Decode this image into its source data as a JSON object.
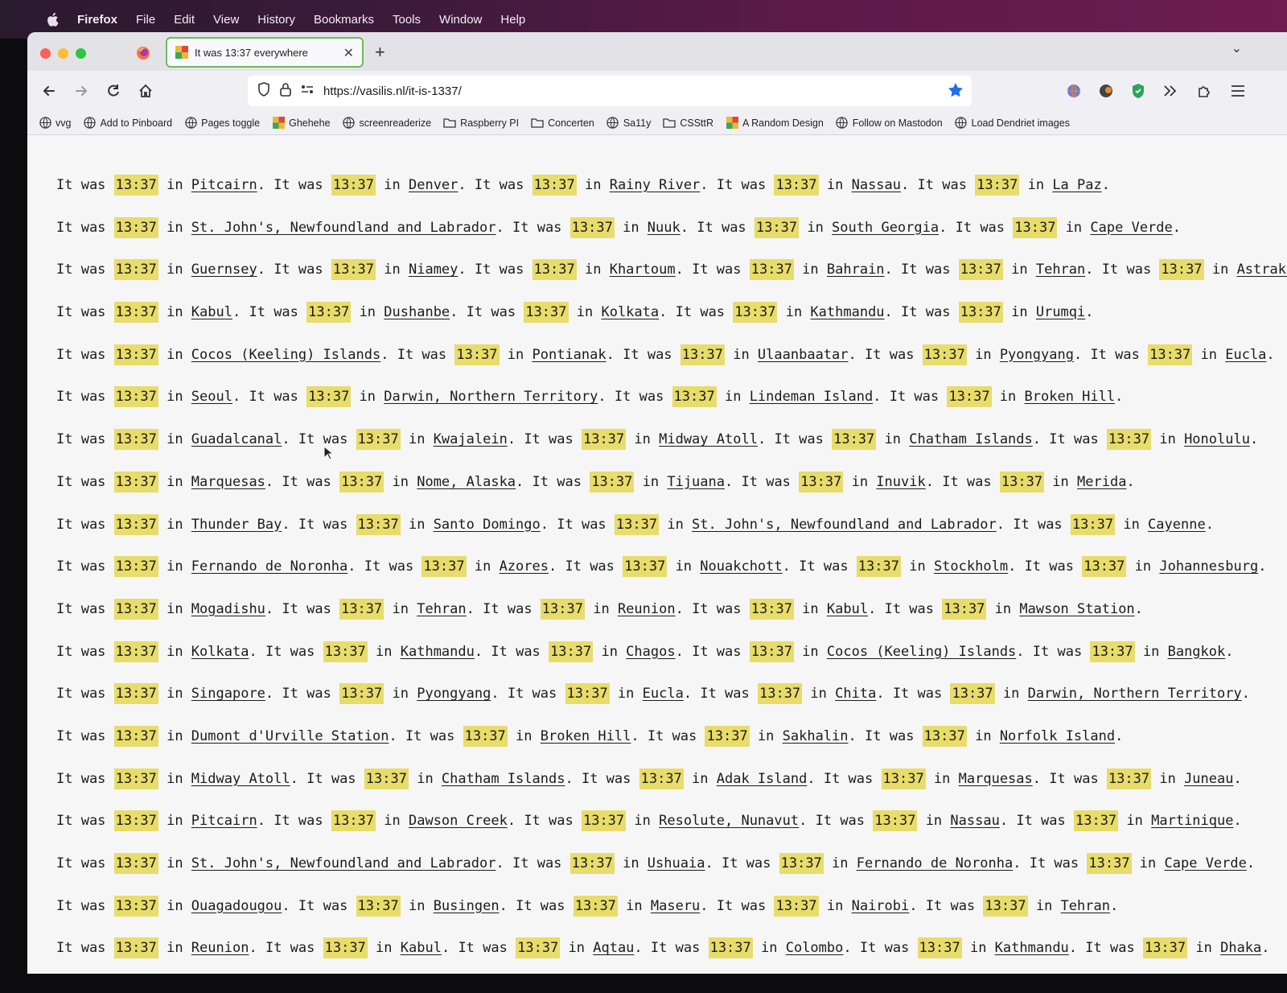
{
  "menubar": {
    "items": [
      "Firefox",
      "File",
      "Edit",
      "View",
      "History",
      "Bookmarks",
      "Tools",
      "Window",
      "Help"
    ]
  },
  "tab": {
    "title": "It was 13:37 everywhere"
  },
  "address": {
    "url": "https://vasilis.nl/it-is-1337/"
  },
  "bookmarks": [
    "vvg",
    "Add to Pinboard",
    "Pages toggle",
    "Ghehehe",
    "screenreaderize",
    "Raspberry PI",
    "Concerten",
    "Sa11y",
    "CSSttR",
    "A Random Design",
    "Follow on Mastodon",
    "Load Dendriet images"
  ],
  "content": {
    "prefix": "It was",
    "time": "13:37",
    "connector": "in",
    "lines": [
      [
        "Pitcairn",
        "Denver",
        "Rainy River",
        "Nassau",
        "La Paz"
      ],
      [
        "St. John's, Newfoundland and Labrador",
        "Nuuk",
        "South Georgia",
        "Cape Verde"
      ],
      [
        "Guernsey",
        "Niamey",
        "Khartoum",
        "Bahrain",
        "Tehran",
        "Astrakhan"
      ],
      [
        "Kabul",
        "Dushanbe",
        "Kolkata",
        "Kathmandu",
        "Urumqi"
      ],
      [
        "Cocos (Keeling) Islands",
        "Pontianak",
        "Ulaanbaatar",
        "Pyongyang",
        "Eucla"
      ],
      [
        "Seoul",
        "Darwin, Northern Territory",
        "Lindeman Island",
        "Broken Hill"
      ],
      [
        "Guadalcanal",
        "Kwajalein",
        "Midway Atoll",
        "Chatham Islands",
        "Honolulu"
      ],
      [
        "Marquesas",
        "Nome, Alaska",
        "Tijuana",
        "Inuvik",
        "Merida"
      ],
      [
        "Thunder Bay",
        "Santo Domingo",
        "St. John's, Newfoundland and Labrador",
        "Cayenne"
      ],
      [
        "Fernando de Noronha",
        "Azores",
        "Nouakchott",
        "Stockholm",
        "Johannesburg"
      ],
      [
        "Mogadishu",
        "Tehran",
        "Reunion",
        "Kabul",
        "Mawson Station"
      ],
      [
        "Kolkata",
        "Kathmandu",
        "Chagos",
        "Cocos (Keeling) Islands",
        "Bangkok"
      ],
      [
        "Singapore",
        "Pyongyang",
        "Eucla",
        "Chita",
        "Darwin, Northern Territory"
      ],
      [
        "Dumont d'Urville Station",
        "Broken Hill",
        "Sakhalin",
        "Norfolk Island"
      ],
      [
        "Midway Atoll",
        "Chatham Islands",
        "Adak Island",
        "Marquesas",
        "Juneau"
      ],
      [
        "Pitcairn",
        "Dawson Creek",
        "Resolute, Nunavut",
        "Nassau",
        "Martinique"
      ],
      [
        "St. John's, Newfoundland and Labrador",
        "Ushuaia",
        "Fernando de Noronha",
        "Cape Verde"
      ],
      [
        "Ouagadougou",
        "Busingen",
        "Maseru",
        "Nairobi",
        "Tehran"
      ],
      [
        "Reunion",
        "Kabul",
        "Aqtau",
        "Colombo",
        "Kathmandu",
        "Dhaka"
      ]
    ]
  },
  "colors": {
    "highlight": "#e8dc6a",
    "tab_border": "#6dbb5c",
    "star": "#1f6fe5"
  }
}
